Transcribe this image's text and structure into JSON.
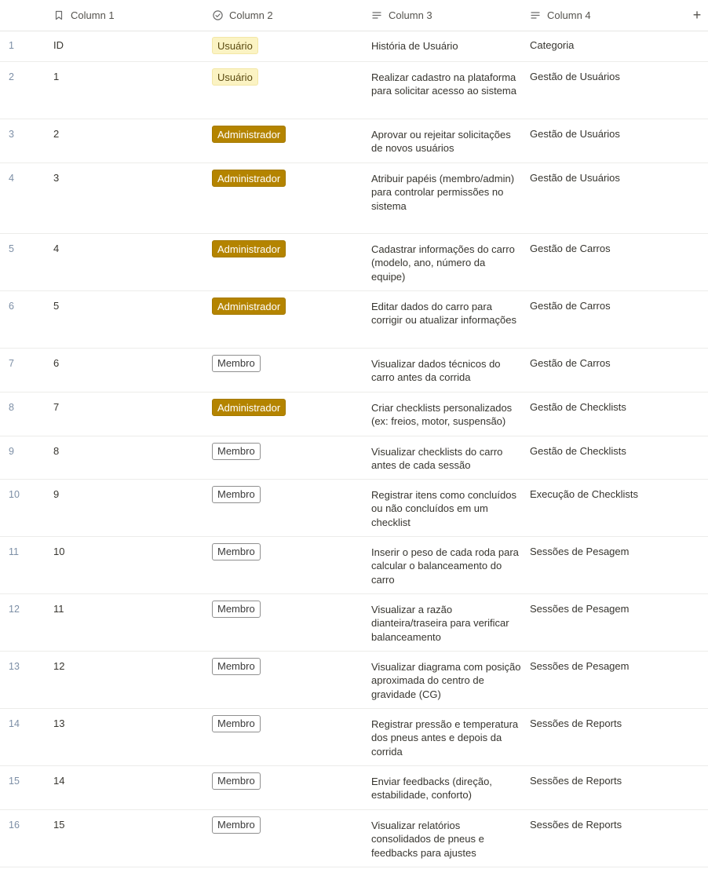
{
  "header": {
    "columns": [
      {
        "label": "Column 1",
        "icon": "bookmark-icon"
      },
      {
        "label": "Column 2",
        "icon": "circle-check-icon"
      },
      {
        "label": "Column 3",
        "icon": "text-lines-icon"
      },
      {
        "label": "Column 4",
        "icon": "text-lines-icon"
      }
    ],
    "add_column": "+"
  },
  "colors": {
    "usuario_bg": "#fbf3c3",
    "admin_bg": "#b48400",
    "row_number": "#7d8fa6"
  },
  "rows": [
    {
      "n": "1",
      "c1": "ID",
      "c2": "Usuário",
      "c3": "História de Usuário",
      "c4": "Categoria"
    },
    {
      "n": "2",
      "c1": "1",
      "c2": "Usuário",
      "c3": "Realizar cadastro na plataforma para solicitar acesso ao sistema",
      "c4": "Gestão de Usuários"
    },
    {
      "n": "3",
      "c1": "2",
      "c2": "Administrador",
      "c3": "Aprovar ou rejeitar solicitações de novos usuários",
      "c4": "Gestão de Usuários"
    },
    {
      "n": "4",
      "c1": "3",
      "c2": "Administrador",
      "c3": "Atribuir papéis (membro/admin) para controlar permissões no sistema",
      "c4": "Gestão de Usuários"
    },
    {
      "n": "5",
      "c1": "4",
      "c2": "Administrador",
      "c3": "Cadastrar informações do carro (modelo, ano, número da equipe)",
      "c4": "Gestão de Carros"
    },
    {
      "n": "6",
      "c1": "5",
      "c2": "Administrador",
      "c3": "Editar dados do carro para corrigir ou atualizar informações",
      "c4": "Gestão de Carros"
    },
    {
      "n": "7",
      "c1": "6",
      "c2": "Membro",
      "c3": "Visualizar dados técnicos do carro antes da corrida",
      "c4": "Gestão de Carros"
    },
    {
      "n": "8",
      "c1": "7",
      "c2": "Administrador",
      "c3": "Criar checklists personalizados (ex: freios, motor, suspensão)",
      "c4": "Gestão de Checklists"
    },
    {
      "n": "9",
      "c1": "8",
      "c2": "Membro",
      "c3": "Visualizar checklists do carro antes de cada sessão",
      "c4": "Gestão de Checklists"
    },
    {
      "n": "10",
      "c1": "9",
      "c2": "Membro",
      "c3": "Registrar itens como concluídos ou não concluídos em um checklist",
      "c4": "Execução de Checklists"
    },
    {
      "n": "11",
      "c1": "10",
      "c2": "Membro",
      "c3": "Inserir o peso de cada roda para calcular o balanceamento do carro",
      "c4": "Sessões de Pesagem"
    },
    {
      "n": "12",
      "c1": "11",
      "c2": "Membro",
      "c3": "Visualizar a razão dianteira/traseira para verificar balanceamento",
      "c4": "Sessões de Pesagem"
    },
    {
      "n": "13",
      "c1": "12",
      "c2": "Membro",
      "c3": "Visualizar diagrama com posição aproximada do centro de gravidade (CG)",
      "c4": "Sessões de Pesagem"
    },
    {
      "n": "14",
      "c1": "13",
      "c2": "Membro",
      "c3": "Registrar pressão e temperatura dos pneus antes e depois da corrida",
      "c4": "Sessões de Reports"
    },
    {
      "n": "15",
      "c1": "14",
      "c2": "Membro",
      "c3": "Enviar feedbacks (direção, estabilidade, conforto)",
      "c4": "Sessões de Reports"
    },
    {
      "n": "16",
      "c1": "15",
      "c2": "Membro",
      "c3": "Visualizar relatórios consolidados de pneus e feedbacks para ajustes",
      "c4": "Sessões de Reports"
    }
  ]
}
